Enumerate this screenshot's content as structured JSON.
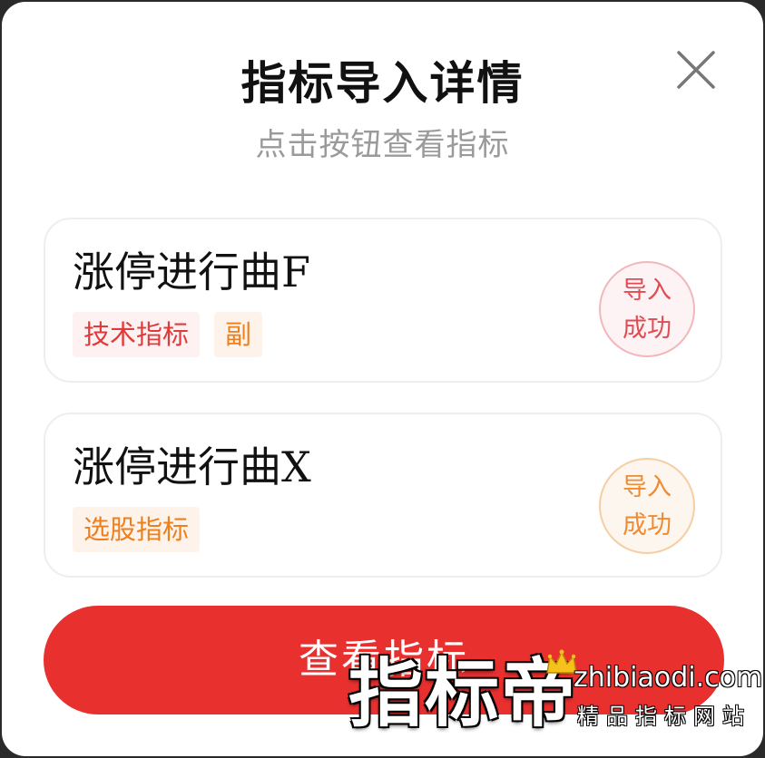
{
  "dialog": {
    "title": "指标导入详情",
    "subtitle": "点击按钮查看指标",
    "close_icon": "close-icon"
  },
  "items": [
    {
      "name": "涨停进行曲F",
      "tags": [
        "技术指标",
        "副"
      ],
      "status": [
        "导入",
        "成功"
      ]
    },
    {
      "name": "涨停进行曲X",
      "tags": [
        "选股指标"
      ],
      "status": [
        "导入",
        "成功"
      ]
    }
  ],
  "primary_button": {
    "label": "查看指标",
    "color": "#e8302f"
  },
  "watermark": {
    "brand": "指标帝",
    "domain": "zhibiaodi.com",
    "slogan": "精品指标网站",
    "icon": "crown-icon"
  },
  "colors": {
    "accent_red": "#e8302f",
    "tag_red": "#e03a3a",
    "tag_orange": "#ee7f1e"
  }
}
